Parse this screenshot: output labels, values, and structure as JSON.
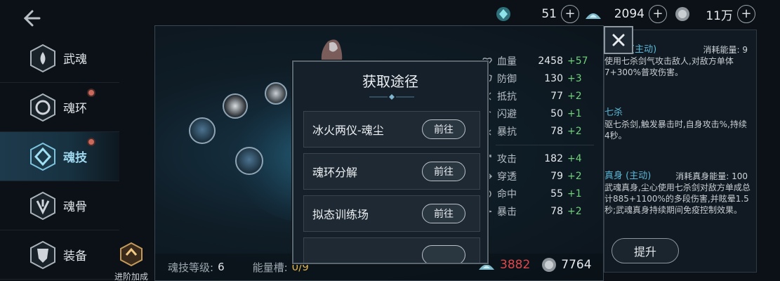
{
  "currency": [
    {
      "icon": "soul-crystal-icon",
      "amount": "51"
    },
    {
      "icon": "soul-dust-icon",
      "amount": "2094"
    },
    {
      "icon": "silver-coin-icon",
      "amount": "11万"
    }
  ],
  "nav": {
    "items": [
      {
        "label": "武魂",
        "icon": "martial-soul-icon",
        "active": false,
        "dot": false
      },
      {
        "label": "魂环",
        "icon": "soul-ring-icon",
        "active": false,
        "dot": true
      },
      {
        "label": "魂技",
        "icon": "soul-skill-icon",
        "active": true,
        "dot": true
      },
      {
        "label": "魂骨",
        "icon": "soul-bone-icon",
        "active": false,
        "dot": false
      },
      {
        "label": "装备",
        "icon": "equipment-icon",
        "active": false,
        "dot": false
      }
    ],
    "advance_label": "进阶加成"
  },
  "skill_panel": {
    "level_label": "魂技等级:",
    "level_value": "6",
    "energy_label": "能量槽:",
    "energy_value": "0/9"
  },
  "stats": [
    {
      "label": "血量",
      "value": "2458",
      "bonus": "+57",
      "icon": "hp-icon"
    },
    {
      "label": "防御",
      "value": "130",
      "bonus": "+3",
      "icon": "defense-icon"
    },
    {
      "label": "抵抗",
      "value": "77",
      "bonus": "+2",
      "icon": "resist-icon"
    },
    {
      "label": "闪避",
      "value": "50",
      "bonus": "+1",
      "icon": "dodge-icon"
    },
    {
      "label": "暴抗",
      "value": "78",
      "bonus": "+2",
      "icon": "crit-resist-icon"
    },
    {
      "label": "攻击",
      "value": "182",
      "bonus": "+4",
      "icon": "attack-icon"
    },
    {
      "label": "穿透",
      "value": "79",
      "bonus": "+2",
      "icon": "pierce-icon"
    },
    {
      "label": "命中",
      "value": "55",
      "bonus": "+1",
      "icon": "accuracy-icon"
    },
    {
      "label": "暴击",
      "value": "78",
      "bonus": "+2",
      "icon": "crit-icon"
    }
  ],
  "cost": {
    "dust_amount": "3882",
    "coin_amount": "7764"
  },
  "description": {
    "skill1_title": "(主动)",
    "skill1_cost": "消耗能量: 9",
    "skill1_text": "使用七杀剑气攻击敌人,对敌方单体7+300%普攻伤害。",
    "skill2_title": "七杀",
    "skill2_text": "驱七杀剑,触发暴击时,自身攻击%,持续4秒。",
    "skill3_title": "真身 (主动)",
    "skill3_cost": "消耗真身能量: 100",
    "skill3_text": "武魂真身,尘心使用七杀剑对敌方单成总计885+1100%的多段伤害,并眩晕1.5秒;武魂真身持续期间免疫控制效果。",
    "upgrade_label": "提升"
  },
  "modal": {
    "title": "获取途径",
    "routes": [
      {
        "label": "冰火两仪-魂尘",
        "button": "前往"
      },
      {
        "label": "魂环分解",
        "button": "前往"
      },
      {
        "label": "拟态训练场",
        "button": "前往"
      }
    ]
  },
  "colors": {
    "bonus_green": "#6fd07a",
    "insufficient_red": "#e0484a",
    "skill_title_blue": "#5ab8d8"
  }
}
